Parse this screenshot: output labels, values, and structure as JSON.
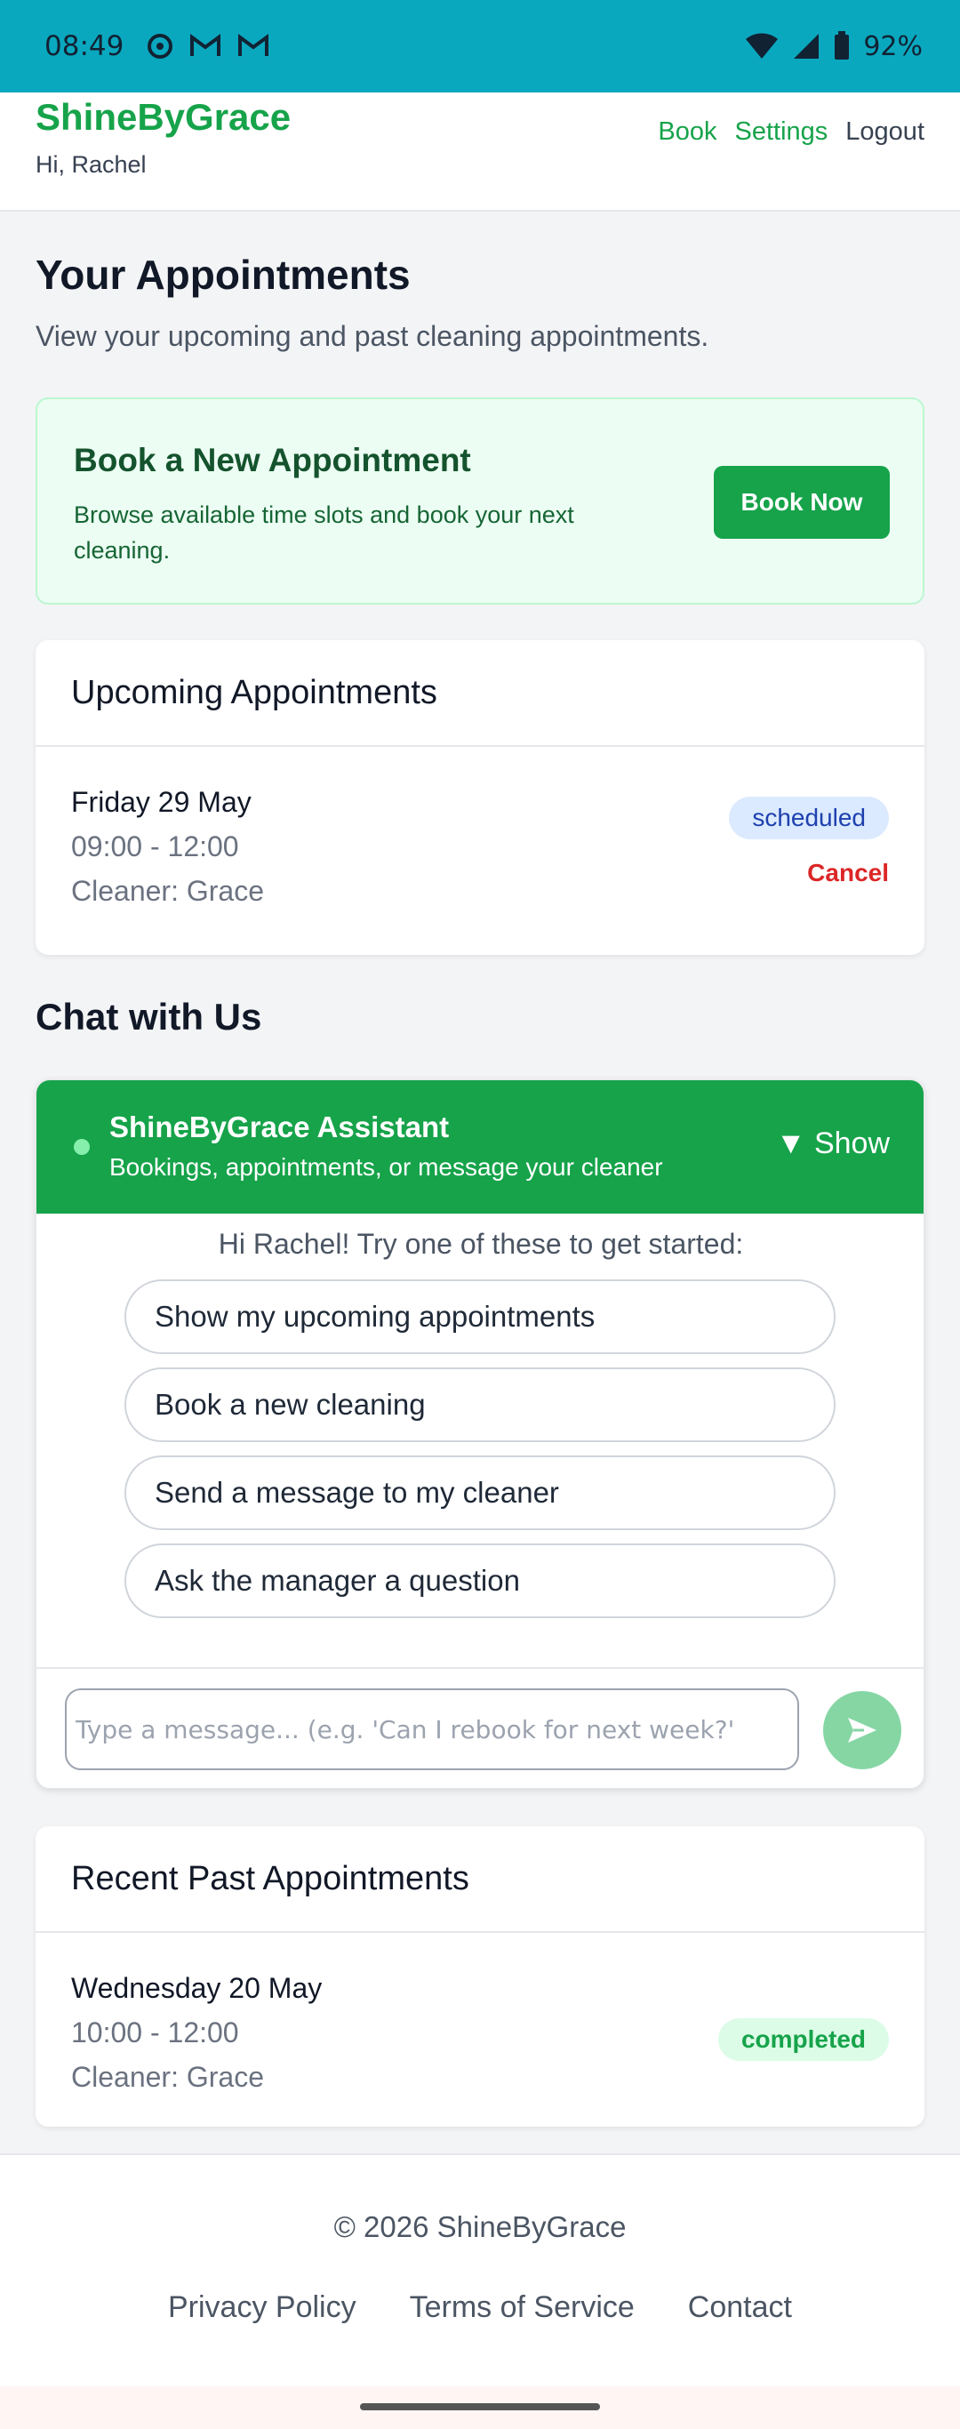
{
  "status_bar": {
    "time": "08:49",
    "battery": "92%"
  },
  "header": {
    "brand": "ShineByGrace",
    "greeting": "Hi, Rachel",
    "nav": {
      "book": "Book",
      "settings": "Settings",
      "logout": "Logout"
    }
  },
  "page": {
    "title": "Your Appointments",
    "subtitle": "View your upcoming and past cleaning appointments."
  },
  "book_card": {
    "title": "Book a New Appointment",
    "description": "Browse available time slots and book your next cleaning.",
    "button": "Book Now"
  },
  "upcoming": {
    "title": "Upcoming Appointments",
    "items": [
      {
        "day": "Friday 29 May",
        "time": "09:00 - 12:00",
        "cleaner": "Cleaner: Grace",
        "status": "scheduled",
        "action": "Cancel"
      }
    ]
  },
  "chat": {
    "section_title": "Chat with Us",
    "title": "ShineByGrace Assistant",
    "subtitle": "Bookings, appointments, or message your cleaner",
    "toggle": "▼ Show",
    "hint": "Hi Rachel! Try one of these to get started:",
    "suggestions": [
      "Show my upcoming appointments",
      "Book a new cleaning",
      "Send a message to my cleaner",
      "Ask the manager a question"
    ],
    "input_placeholder": "Type a message... (e.g. 'Can I rebook for next week?'",
    "input_value": ""
  },
  "past": {
    "title": "Recent Past Appointments",
    "items": [
      {
        "day": "Wednesday 20 May",
        "time": "10:00 - 12:00",
        "cleaner": "Cleaner: Grace",
        "status": "completed"
      }
    ]
  },
  "footer": {
    "copyright": "© 2026 ShineByGrace",
    "links": [
      "Privacy Policy",
      "Terms of Service",
      "Contact"
    ]
  },
  "colors": {
    "brand_green": "#16a34a",
    "status_bar": "#0aa8bf",
    "danger": "#dc2626"
  }
}
